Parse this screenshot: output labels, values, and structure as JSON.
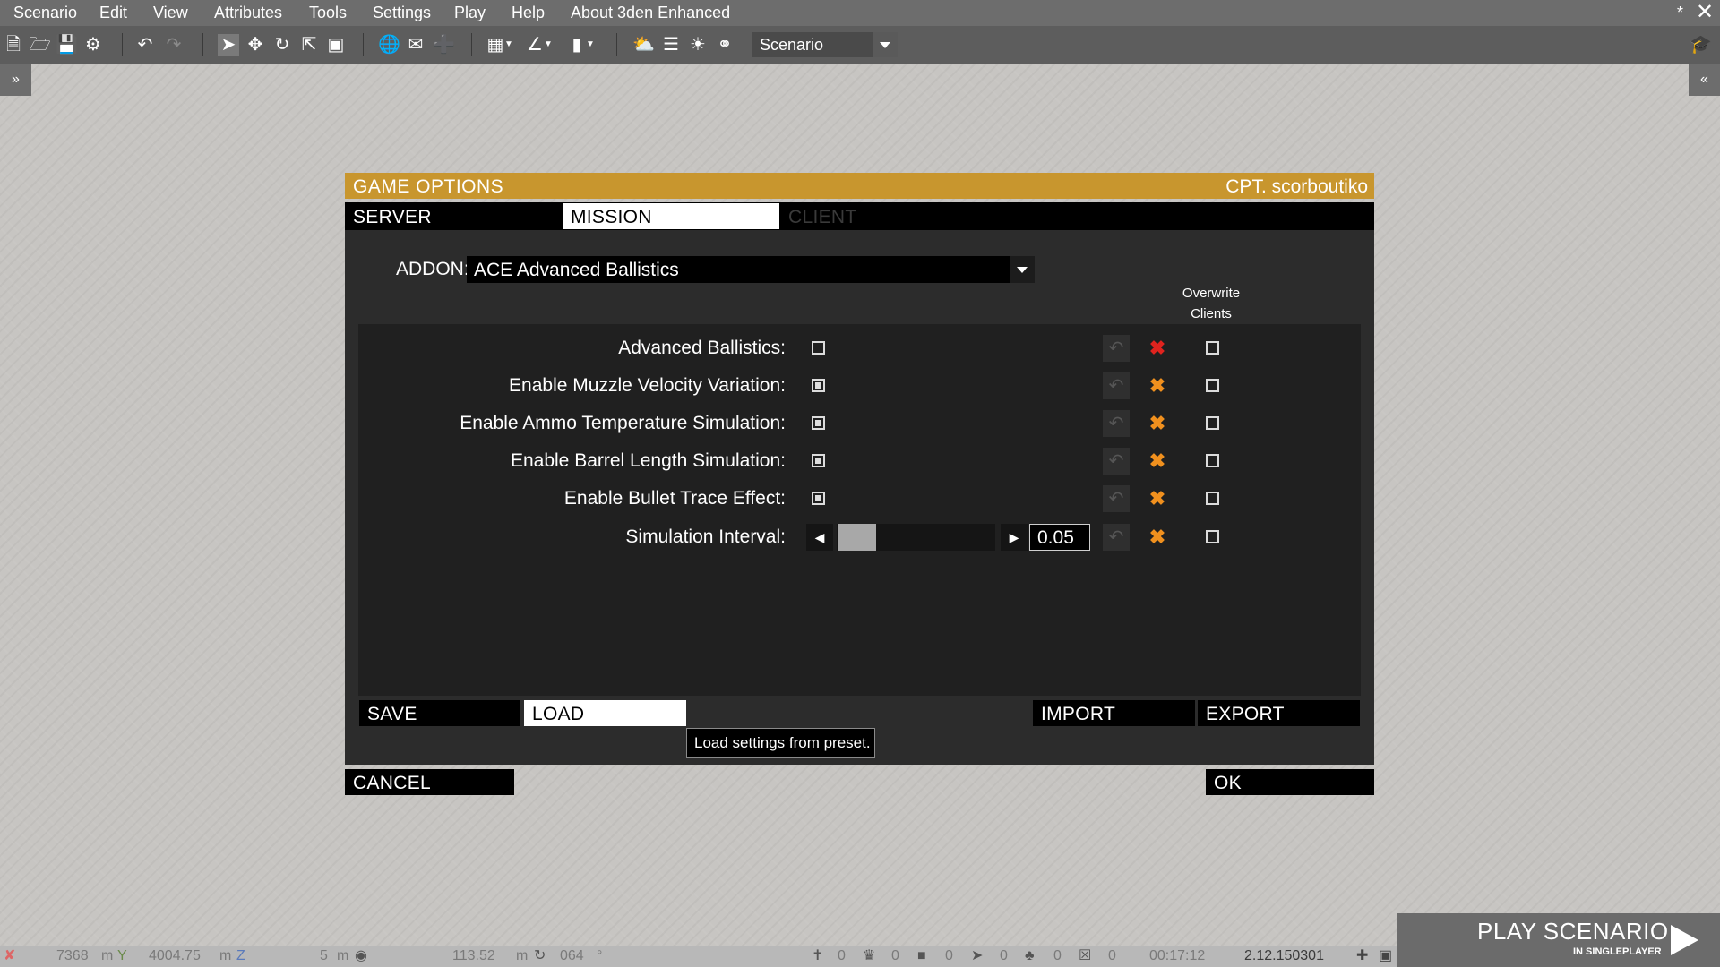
{
  "menu": {
    "items": [
      "Scenario",
      "Edit",
      "View",
      "Attributes",
      "Tools",
      "Settings",
      "Play",
      "Help",
      "About 3den Enhanced"
    ],
    "asterisk": "*",
    "close_glyph": "✕"
  },
  "toolbar": {
    "icons": [
      "new-file-icon",
      "open-folder-icon",
      "save-icon",
      "steam-icon",
      "undo-icon",
      "redo-icon",
      "select-cursor-icon",
      "move-icon",
      "rotate-icon",
      "scale-icon",
      "bounding-box-icon",
      "globe-icon",
      "envelope-icon",
      "vertical-snap-icon",
      "grid-icon",
      "angle-icon",
      "terrain-icon",
      "weather-icon",
      "library-icon",
      "sun-icon",
      "binoculars-icon"
    ],
    "scenario_select": "Scenario"
  },
  "sidebar": {
    "left_toggle": "»",
    "right_toggle": "«"
  },
  "dialog": {
    "title": "GAME OPTIONS",
    "user": "CPT. scorboutiko",
    "tabs": [
      {
        "label": "SERVER",
        "state": "inactive"
      },
      {
        "label": "MISSION",
        "state": "active"
      },
      {
        "label": "CLIENT",
        "state": "disabled"
      }
    ],
    "addon_label": "ADDON:",
    "addon_value": "ACE Advanced Ballistics",
    "overwrite_header_line1": "Overwrite",
    "overwrite_header_line2": "Clients",
    "settings": [
      {
        "label": "Advanced Ballistics:",
        "type": "checkbox",
        "checked": false,
        "x_color": "#e0231e",
        "overwrite": false
      },
      {
        "label": "Enable Muzzle Velocity Variation:",
        "type": "checkbox",
        "checked": true,
        "x_color": "#f0901e",
        "overwrite": false
      },
      {
        "label": "Enable Ammo Temperature Simulation:",
        "type": "checkbox",
        "checked": true,
        "x_color": "#f0901e",
        "overwrite": false
      },
      {
        "label": "Enable Barrel Length Simulation:",
        "type": "checkbox",
        "checked": true,
        "x_color": "#f0901e",
        "overwrite": false
      },
      {
        "label": "Enable Bullet Trace Effect:",
        "type": "checkbox",
        "checked": true,
        "x_color": "#f0901e",
        "overwrite": false
      },
      {
        "label": "Simulation Interval:",
        "type": "slider",
        "value": "0.05",
        "x_color": "#f0901e",
        "overwrite": false
      }
    ],
    "buttons": {
      "save": "SAVE",
      "load": "LOAD",
      "import": "IMPORT",
      "export": "EXPORT",
      "cancel": "CANCEL",
      "ok": "OK"
    },
    "tooltip": "Load settings from preset."
  },
  "statusbar": {
    "coord_x": "7368",
    "coord_x_unit": "m",
    "coord_y": "4004.75",
    "coord_y_unit": "m",
    "grid": "5",
    "grid_unit": "m",
    "camera_height": "113.52",
    "camera_height_unit": "m",
    "direction": "064",
    "direction_unit": "°",
    "count_units": "0",
    "count_groups": "0",
    "count_triggers": "0",
    "count_waypoints": "0",
    "count_systems": "0",
    "count_markers": "0",
    "time": "00:17:12",
    "version": "2.12.150301"
  },
  "play": {
    "title": "PLAY SCENARIO",
    "subtitle": "IN SINGLEPLAYER"
  },
  "colors": {
    "accent": "#c8962e",
    "error_x": "#e0231e",
    "warn_x": "#f0901e"
  }
}
